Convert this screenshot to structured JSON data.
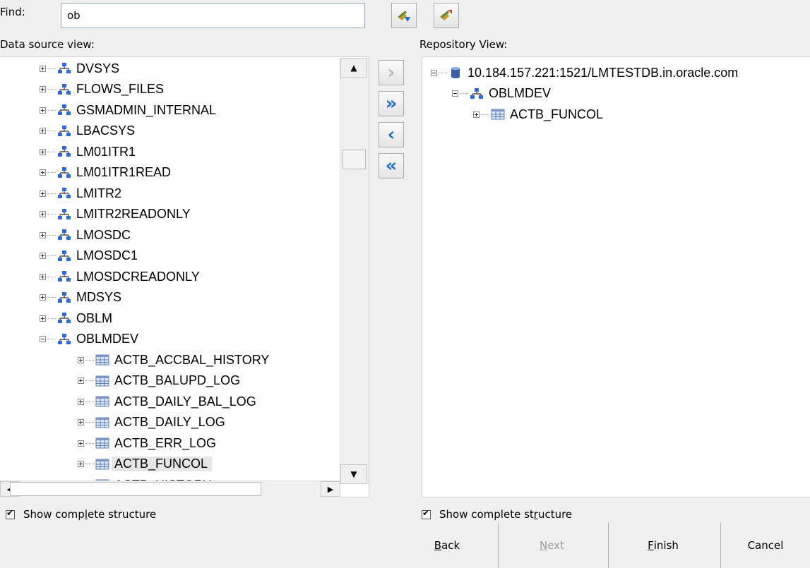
{
  "find": {
    "label": "Find:",
    "value": "ob"
  },
  "find_buttons": [
    {
      "icon": "find-arrow-icon"
    },
    {
      "icon": "find-next-icon"
    }
  ],
  "data_source": {
    "label": "Data source view:",
    "items": [
      {
        "label": "DVSYS",
        "type": "schema",
        "expanded": false
      },
      {
        "label": "FLOWS_FILES",
        "type": "schema",
        "expanded": false
      },
      {
        "label": "GSMADMIN_INTERNAL",
        "type": "schema",
        "expanded": false
      },
      {
        "label": "LBACSYS",
        "type": "schema",
        "expanded": false
      },
      {
        "label": "LM01ITR1",
        "type": "schema",
        "expanded": false
      },
      {
        "label": "LM01ITR1READ",
        "type": "schema",
        "expanded": false
      },
      {
        "label": "LMITR2",
        "type": "schema",
        "expanded": false
      },
      {
        "label": "LMITR2READONLY",
        "type": "schema",
        "expanded": false
      },
      {
        "label": "LMOSDC",
        "type": "schema",
        "expanded": false
      },
      {
        "label": "LMOSDC1",
        "type": "schema",
        "expanded": false
      },
      {
        "label": "LMOSDCREADONLY",
        "type": "schema",
        "expanded": false
      },
      {
        "label": "MDSYS",
        "type": "schema",
        "expanded": false
      },
      {
        "label": "OBLM",
        "type": "schema",
        "expanded": false
      },
      {
        "label": "OBLMDEV",
        "type": "schema",
        "expanded": true
      },
      {
        "label": "ACTB_ACCBAL_HISTORY",
        "type": "table",
        "expanded": false
      },
      {
        "label": "ACTB_BALUPD_LOG",
        "type": "table",
        "expanded": false
      },
      {
        "label": "ACTB_DAILY_BAL_LOG",
        "type": "table",
        "expanded": false
      },
      {
        "label": "ACTB_DAILY_LOG",
        "type": "table",
        "expanded": false
      },
      {
        "label": "ACTB_ERR_LOG",
        "type": "table",
        "expanded": false
      },
      {
        "label": "ACTB_FUNCOL",
        "type": "table",
        "expanded": false,
        "selected": true
      },
      {
        "label": "ACTB_HISTORY",
        "type": "table",
        "expanded": false
      }
    ],
    "show_complete": {
      "pre": "Show comp",
      "accel": "l",
      "post": "ete structure",
      "checked": true
    }
  },
  "repository": {
    "label": "Repository View:",
    "items": [
      {
        "label": "10.184.157.221:1521/LMTESTDB.in.oracle.com",
        "type": "database",
        "expanded": true
      },
      {
        "label": "OBLMDEV",
        "type": "schema",
        "expanded": true
      },
      {
        "label": "ACTB_FUNCOL",
        "type": "table",
        "expanded": false
      }
    ],
    "show_complete": {
      "pre": "Show complete st",
      "accel": "r",
      "post": "ucture",
      "checked": true
    }
  },
  "transfer_buttons": [
    {
      "name": "move-right",
      "symbol": "›",
      "enabled": false
    },
    {
      "name": "move-all-right",
      "symbol": "»",
      "enabled": true
    },
    {
      "name": "move-left",
      "symbol": "‹",
      "enabled": true
    },
    {
      "name": "move-all-left",
      "symbol": "«",
      "enabled": true
    }
  ],
  "wizard": {
    "back": {
      "accel": "B",
      "rest": "ack"
    },
    "next": {
      "accel": "N",
      "rest": "ext"
    },
    "finish": {
      "accel": "F",
      "rest": "inish"
    },
    "cancel": "Cancel"
  },
  "colors": {
    "accent": "#1c6fd0",
    "selected_bg": "#e6e6e6",
    "schema_icon": "#2b6cd8",
    "table_icon": "#5b7db8"
  }
}
